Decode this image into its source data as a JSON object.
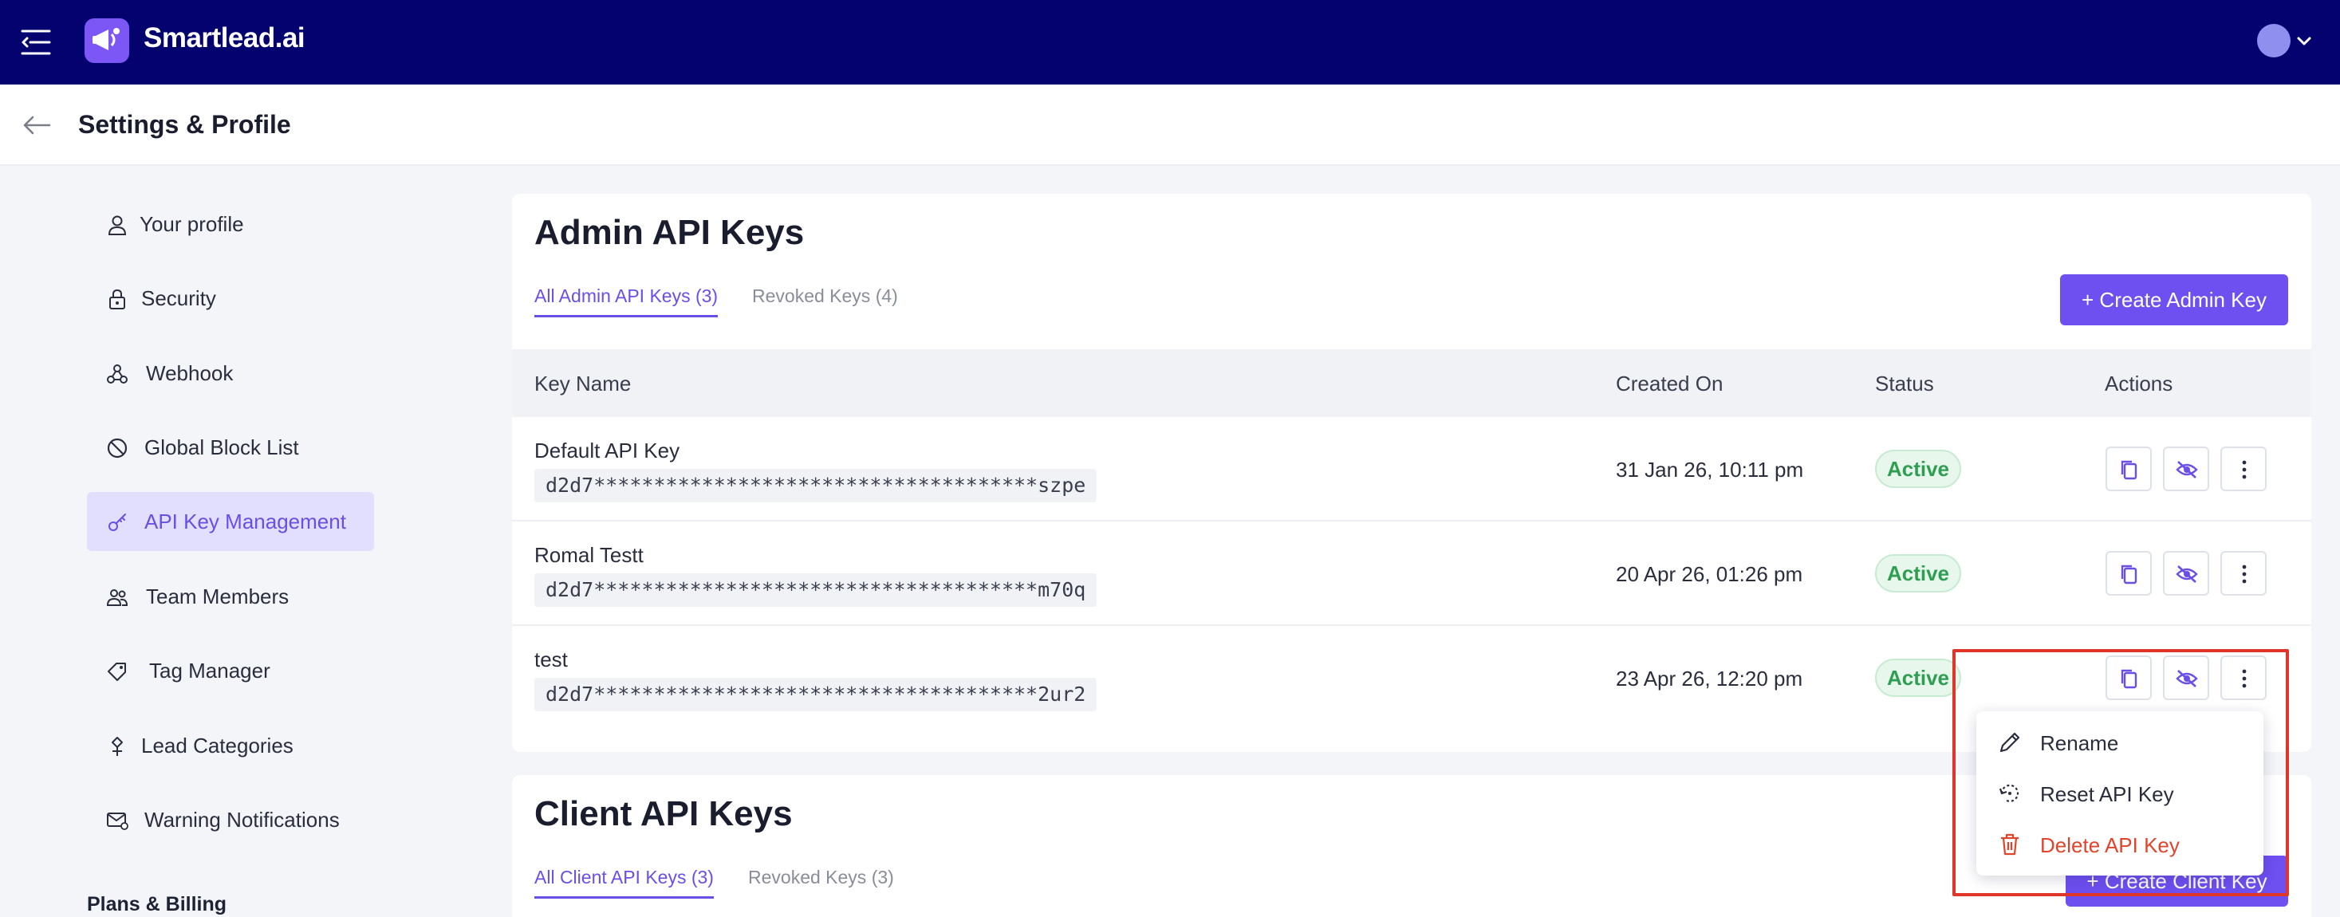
{
  "app": {
    "name": "Smartlead.ai",
    "brand_color": "#03026e",
    "accent_color": "#6e4ff0"
  },
  "header": {
    "page_title": "Settings & Profile"
  },
  "sidebar": {
    "items": [
      {
        "label": "Your profile",
        "icon": "user-icon"
      },
      {
        "label": "Security",
        "icon": "lock-icon"
      },
      {
        "label": "Webhook",
        "icon": "webhook-icon"
      },
      {
        "label": "Global Block List",
        "icon": "block-icon"
      },
      {
        "label": "API Key Management",
        "icon": "key-icon",
        "active": true
      },
      {
        "label": "Team Members",
        "icon": "team-icon"
      },
      {
        "label": "Tag Manager",
        "icon": "tag-icon"
      },
      {
        "label": "Lead Categories",
        "icon": "category-icon"
      },
      {
        "label": "Warning Notifications",
        "icon": "mail-warning-icon"
      }
    ],
    "section_label": "Plans & Billing"
  },
  "admin_keys": {
    "title": "Admin API Keys",
    "tabs": [
      {
        "label": "All Admin API Keys",
        "count": "(3)",
        "active": true
      },
      {
        "label": "Revoked Keys",
        "count": "(4)",
        "active": false
      }
    ],
    "create_button": "+ Create Admin Key",
    "columns": [
      "Key Name",
      "Created On",
      "Status",
      "Actions"
    ],
    "rows": [
      {
        "name": "Default API Key",
        "key": "d2d7*************************************szpe",
        "created": "31 Jan 26, 10:11 pm",
        "status": "Active"
      },
      {
        "name": "Romal Testt",
        "key": "d2d7*************************************m70q",
        "created": "20 Apr 26, 01:26 pm",
        "status": "Active"
      },
      {
        "name": "test",
        "key": "d2d7*************************************2ur2",
        "created": "23 Apr 26, 12:20 pm",
        "status": "Active"
      }
    ]
  },
  "actions_menu": {
    "items": [
      {
        "label": "Rename",
        "icon": "pencil-icon"
      },
      {
        "label": "Reset API Key",
        "icon": "reset-icon"
      },
      {
        "label": "Delete API Key",
        "icon": "trash-icon",
        "danger_color": "#e0452b"
      }
    ]
  },
  "client_keys": {
    "title": "Client API Keys",
    "tabs": [
      {
        "label": "All Client API Keys",
        "count": "(3)",
        "active": true
      },
      {
        "label": "Revoked Keys",
        "count": "(3)",
        "active": false
      }
    ],
    "create_button": "+ Create Client Key"
  }
}
